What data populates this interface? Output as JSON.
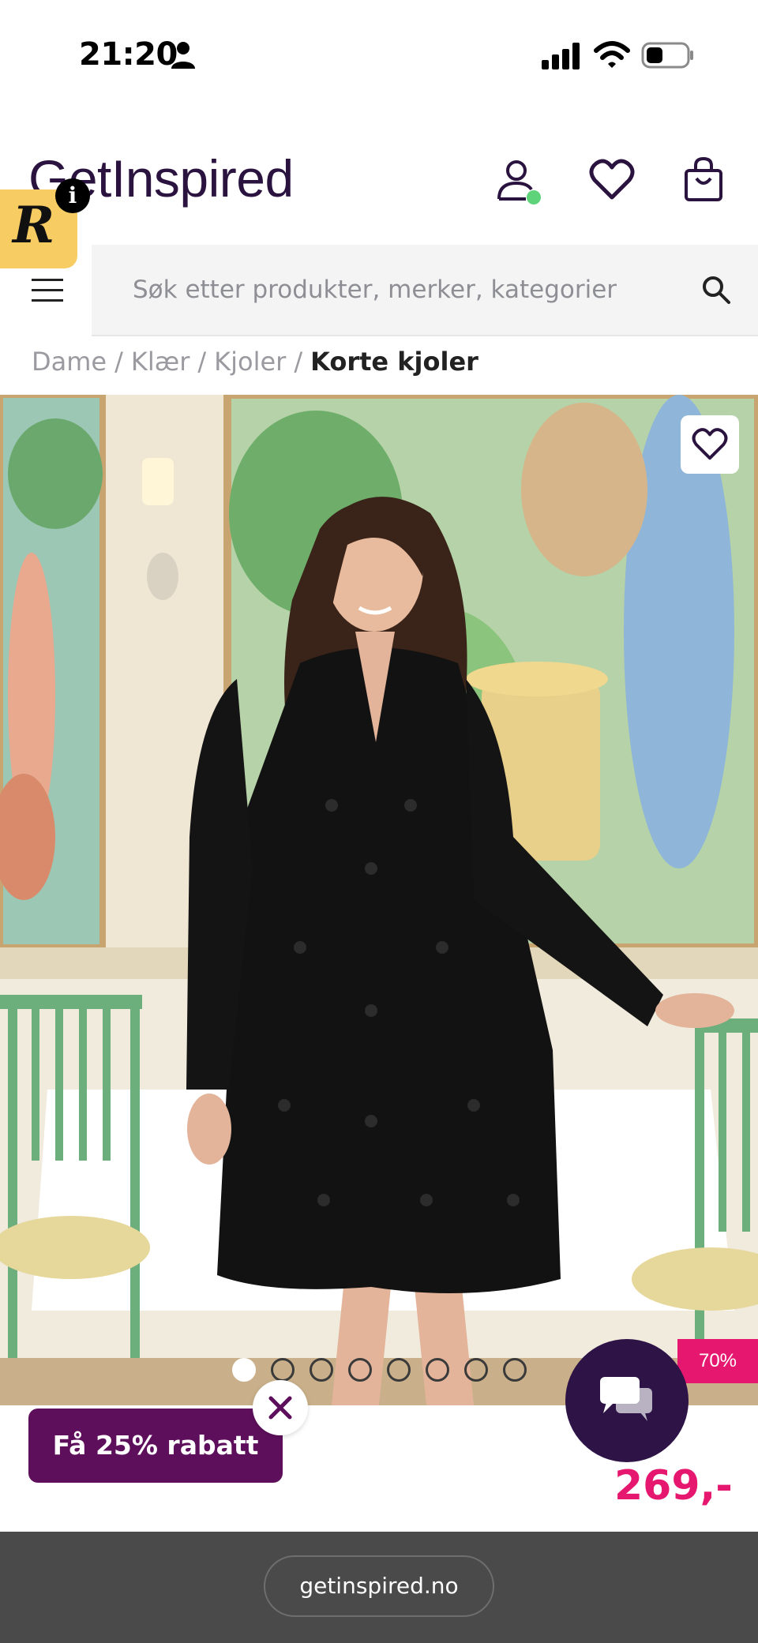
{
  "status_bar": {
    "time": "21:20"
  },
  "header": {
    "logo_text": "GetInspired",
    "brand_color": "#2b1340",
    "badge_letter": "R",
    "info_letter": "i"
  },
  "search": {
    "placeholder": "Søk etter produkter, merker, kategorier"
  },
  "breadcrumb": {
    "items": [
      "Dame",
      "Klær",
      "Kjoler"
    ],
    "separator": "/",
    "current": "Korte kjoler"
  },
  "gallery": {
    "image_count": 8,
    "active_index": 0
  },
  "product": {
    "discount": "70%",
    "price": "269,-",
    "accent_color": "#e6176f"
  },
  "promo": {
    "label": "Få 25% rabatt",
    "color": "#5e0f5c"
  },
  "browser": {
    "url": "getinspired.no"
  },
  "icons": {
    "status": [
      "person-icon",
      "signal-icon",
      "wifi-icon",
      "battery-icon"
    ],
    "header": [
      "account-icon",
      "heart-icon",
      "bag-icon"
    ],
    "other": [
      "menu-icon",
      "search-icon",
      "chat-icon",
      "close-icon"
    ]
  }
}
